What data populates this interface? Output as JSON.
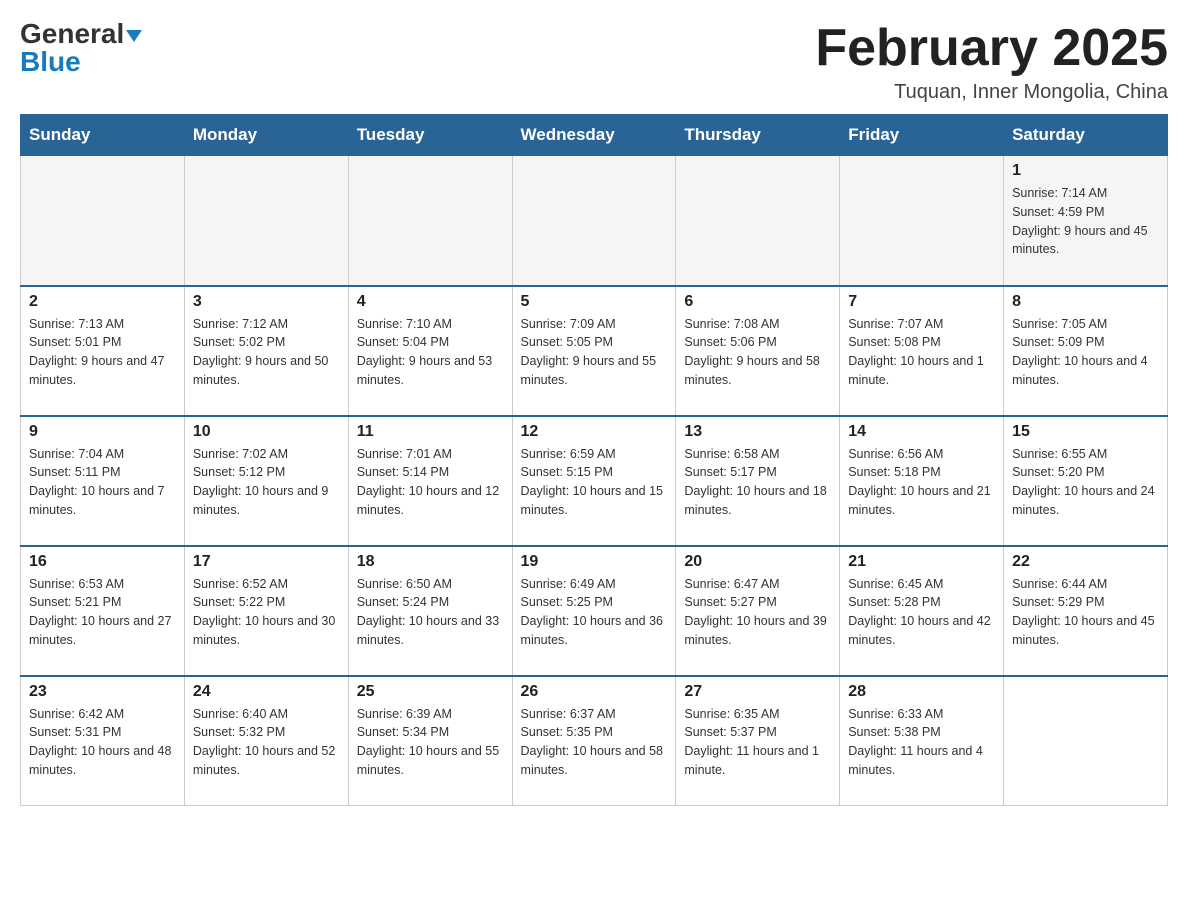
{
  "header": {
    "logo_general": "General",
    "logo_blue": "Blue",
    "month_title": "February 2025",
    "location": "Tuquan, Inner Mongolia, China"
  },
  "days_of_week": [
    "Sunday",
    "Monday",
    "Tuesday",
    "Wednesday",
    "Thursday",
    "Friday",
    "Saturday"
  ],
  "weeks": [
    [
      {
        "day": "",
        "sunrise": "",
        "sunset": "",
        "daylight": ""
      },
      {
        "day": "",
        "sunrise": "",
        "sunset": "",
        "daylight": ""
      },
      {
        "day": "",
        "sunrise": "",
        "sunset": "",
        "daylight": ""
      },
      {
        "day": "",
        "sunrise": "",
        "sunset": "",
        "daylight": ""
      },
      {
        "day": "",
        "sunrise": "",
        "sunset": "",
        "daylight": ""
      },
      {
        "day": "",
        "sunrise": "",
        "sunset": "",
        "daylight": ""
      },
      {
        "day": "1",
        "sunrise": "Sunrise: 7:14 AM",
        "sunset": "Sunset: 4:59 PM",
        "daylight": "Daylight: 9 hours and 45 minutes."
      }
    ],
    [
      {
        "day": "2",
        "sunrise": "Sunrise: 7:13 AM",
        "sunset": "Sunset: 5:01 PM",
        "daylight": "Daylight: 9 hours and 47 minutes."
      },
      {
        "day": "3",
        "sunrise": "Sunrise: 7:12 AM",
        "sunset": "Sunset: 5:02 PM",
        "daylight": "Daylight: 9 hours and 50 minutes."
      },
      {
        "day": "4",
        "sunrise": "Sunrise: 7:10 AM",
        "sunset": "Sunset: 5:04 PM",
        "daylight": "Daylight: 9 hours and 53 minutes."
      },
      {
        "day": "5",
        "sunrise": "Sunrise: 7:09 AM",
        "sunset": "Sunset: 5:05 PM",
        "daylight": "Daylight: 9 hours and 55 minutes."
      },
      {
        "day": "6",
        "sunrise": "Sunrise: 7:08 AM",
        "sunset": "Sunset: 5:06 PM",
        "daylight": "Daylight: 9 hours and 58 minutes."
      },
      {
        "day": "7",
        "sunrise": "Sunrise: 7:07 AM",
        "sunset": "Sunset: 5:08 PM",
        "daylight": "Daylight: 10 hours and 1 minute."
      },
      {
        "day": "8",
        "sunrise": "Sunrise: 7:05 AM",
        "sunset": "Sunset: 5:09 PM",
        "daylight": "Daylight: 10 hours and 4 minutes."
      }
    ],
    [
      {
        "day": "9",
        "sunrise": "Sunrise: 7:04 AM",
        "sunset": "Sunset: 5:11 PM",
        "daylight": "Daylight: 10 hours and 7 minutes."
      },
      {
        "day": "10",
        "sunrise": "Sunrise: 7:02 AM",
        "sunset": "Sunset: 5:12 PM",
        "daylight": "Daylight: 10 hours and 9 minutes."
      },
      {
        "day": "11",
        "sunrise": "Sunrise: 7:01 AM",
        "sunset": "Sunset: 5:14 PM",
        "daylight": "Daylight: 10 hours and 12 minutes."
      },
      {
        "day": "12",
        "sunrise": "Sunrise: 6:59 AM",
        "sunset": "Sunset: 5:15 PM",
        "daylight": "Daylight: 10 hours and 15 minutes."
      },
      {
        "day": "13",
        "sunrise": "Sunrise: 6:58 AM",
        "sunset": "Sunset: 5:17 PM",
        "daylight": "Daylight: 10 hours and 18 minutes."
      },
      {
        "day": "14",
        "sunrise": "Sunrise: 6:56 AM",
        "sunset": "Sunset: 5:18 PM",
        "daylight": "Daylight: 10 hours and 21 minutes."
      },
      {
        "day": "15",
        "sunrise": "Sunrise: 6:55 AM",
        "sunset": "Sunset: 5:20 PM",
        "daylight": "Daylight: 10 hours and 24 minutes."
      }
    ],
    [
      {
        "day": "16",
        "sunrise": "Sunrise: 6:53 AM",
        "sunset": "Sunset: 5:21 PM",
        "daylight": "Daylight: 10 hours and 27 minutes."
      },
      {
        "day": "17",
        "sunrise": "Sunrise: 6:52 AM",
        "sunset": "Sunset: 5:22 PM",
        "daylight": "Daylight: 10 hours and 30 minutes."
      },
      {
        "day": "18",
        "sunrise": "Sunrise: 6:50 AM",
        "sunset": "Sunset: 5:24 PM",
        "daylight": "Daylight: 10 hours and 33 minutes."
      },
      {
        "day": "19",
        "sunrise": "Sunrise: 6:49 AM",
        "sunset": "Sunset: 5:25 PM",
        "daylight": "Daylight: 10 hours and 36 minutes."
      },
      {
        "day": "20",
        "sunrise": "Sunrise: 6:47 AM",
        "sunset": "Sunset: 5:27 PM",
        "daylight": "Daylight: 10 hours and 39 minutes."
      },
      {
        "day": "21",
        "sunrise": "Sunrise: 6:45 AM",
        "sunset": "Sunset: 5:28 PM",
        "daylight": "Daylight: 10 hours and 42 minutes."
      },
      {
        "day": "22",
        "sunrise": "Sunrise: 6:44 AM",
        "sunset": "Sunset: 5:29 PM",
        "daylight": "Daylight: 10 hours and 45 minutes."
      }
    ],
    [
      {
        "day": "23",
        "sunrise": "Sunrise: 6:42 AM",
        "sunset": "Sunset: 5:31 PM",
        "daylight": "Daylight: 10 hours and 48 minutes."
      },
      {
        "day": "24",
        "sunrise": "Sunrise: 6:40 AM",
        "sunset": "Sunset: 5:32 PM",
        "daylight": "Daylight: 10 hours and 52 minutes."
      },
      {
        "day": "25",
        "sunrise": "Sunrise: 6:39 AM",
        "sunset": "Sunset: 5:34 PM",
        "daylight": "Daylight: 10 hours and 55 minutes."
      },
      {
        "day": "26",
        "sunrise": "Sunrise: 6:37 AM",
        "sunset": "Sunset: 5:35 PM",
        "daylight": "Daylight: 10 hours and 58 minutes."
      },
      {
        "day": "27",
        "sunrise": "Sunrise: 6:35 AM",
        "sunset": "Sunset: 5:37 PM",
        "daylight": "Daylight: 11 hours and 1 minute."
      },
      {
        "day": "28",
        "sunrise": "Sunrise: 6:33 AM",
        "sunset": "Sunset: 5:38 PM",
        "daylight": "Daylight: 11 hours and 4 minutes."
      },
      {
        "day": "",
        "sunrise": "",
        "sunset": "",
        "daylight": ""
      }
    ]
  ]
}
